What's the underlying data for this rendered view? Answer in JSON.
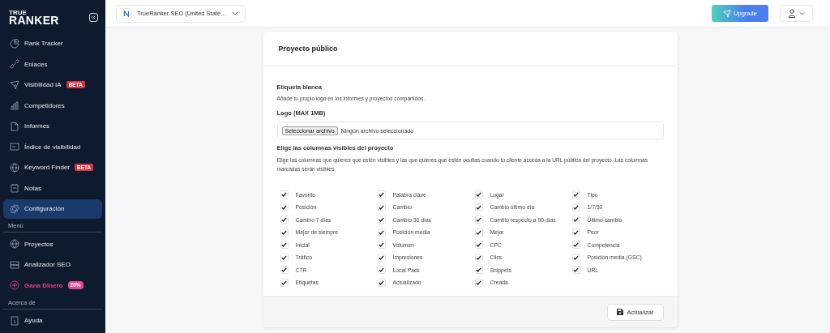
{
  "logo": {
    "top": "TRUE",
    "bottom": "RANKER"
  },
  "sidebar": {
    "items": [
      {
        "label": "Rank Tracker",
        "selected": false,
        "kind": "normal"
      },
      {
        "label": "Enlaces",
        "selected": false,
        "kind": "normal"
      },
      {
        "label": "Visibilidad IA",
        "selected": false,
        "kind": "normal",
        "badge": "BETA"
      },
      {
        "label": "Competidores",
        "selected": false,
        "kind": "normal"
      },
      {
        "label": "Informes",
        "selected": false,
        "kind": "normal"
      },
      {
        "label": "Índice de visibilidad",
        "selected": false,
        "kind": "normal"
      },
      {
        "label": "Keyword Finder",
        "selected": false,
        "kind": "normal",
        "badge": "BETA"
      },
      {
        "label": "Notas",
        "selected": false,
        "kind": "normal"
      },
      {
        "label": "Configuración",
        "selected": true,
        "kind": "normal"
      }
    ],
    "sections": [
      {
        "title": "Menú",
        "items": [
          {
            "label": "Proyectos",
            "selected": false,
            "kind": "normal"
          },
          {
            "label": "Analizador SEO",
            "selected": false,
            "kind": "normal"
          },
          {
            "label": "Gana Dinero",
            "selected": false,
            "kind": "promo",
            "badge": "20%"
          }
        ]
      },
      {
        "title": "Acerca de",
        "items": [
          {
            "label": "Ayuda",
            "selected": false,
            "kind": "normal"
          }
        ]
      }
    ]
  },
  "topbar": {
    "project": "TrueRanker SEO (United State…",
    "upgrade": "Upgrade"
  },
  "card": {
    "title": "Proyecto público",
    "white_label": {
      "title": "Etiqueta blanca",
      "description": "Añade tu propio logo en los informes y proyectos compartidos."
    },
    "logo_field": {
      "label": "Logo (MAX 1MB)",
      "button": "Seleccionar archivo",
      "value": "Ningún archivo seleccionado"
    },
    "columns": {
      "title": "Elige las columnas visibles del proyecto",
      "description": "Elige las columnas que quieres que estén visibles y las que quieres que estén ocultas cuando tu cliente acceda a la URL pública del proyecto. Las columnas marcadas serán visibles.",
      "options": [
        {
          "label": "Favorito",
          "checked": true
        },
        {
          "label": "Palabra clave",
          "checked": true
        },
        {
          "label": "Lugar",
          "checked": true
        },
        {
          "label": "Tipo",
          "checked": true
        },
        {
          "label": "Posición",
          "checked": true
        },
        {
          "label": "Cambio",
          "checked": true
        },
        {
          "label": "Cambio último día",
          "checked": true
        },
        {
          "label": "1/7/30",
          "checked": true
        },
        {
          "label": "Cambio 7 días",
          "checked": true
        },
        {
          "label": "Cambio 30 días",
          "checked": true
        },
        {
          "label": "Cambio respecto a 90 días",
          "checked": true
        },
        {
          "label": "Último cambio",
          "checked": true
        },
        {
          "label": "Mejor de siempre",
          "checked": true
        },
        {
          "label": "Posición media",
          "checked": true
        },
        {
          "label": "Mejor",
          "checked": true
        },
        {
          "label": "Peor",
          "checked": true
        },
        {
          "label": "Inicial",
          "checked": true
        },
        {
          "label": "Volumen",
          "checked": true
        },
        {
          "label": "CPC",
          "checked": true
        },
        {
          "label": "Competencia",
          "checked": true
        },
        {
          "label": "Tráfico",
          "checked": true
        },
        {
          "label": "Impresiones",
          "checked": true
        },
        {
          "label": "Clics",
          "checked": true
        },
        {
          "label": "Posición media (GSC)",
          "checked": true
        },
        {
          "label": "CTR",
          "checked": true
        },
        {
          "label": "Local Pack",
          "checked": true
        },
        {
          "label": "Snippets",
          "checked": true
        },
        {
          "label": "URL",
          "checked": true
        },
        {
          "label": "Etiquetas",
          "checked": true
        },
        {
          "label": "Actualizado",
          "checked": true
        },
        {
          "label": "Creada",
          "checked": true
        }
      ]
    },
    "submit": "Actualizar"
  }
}
